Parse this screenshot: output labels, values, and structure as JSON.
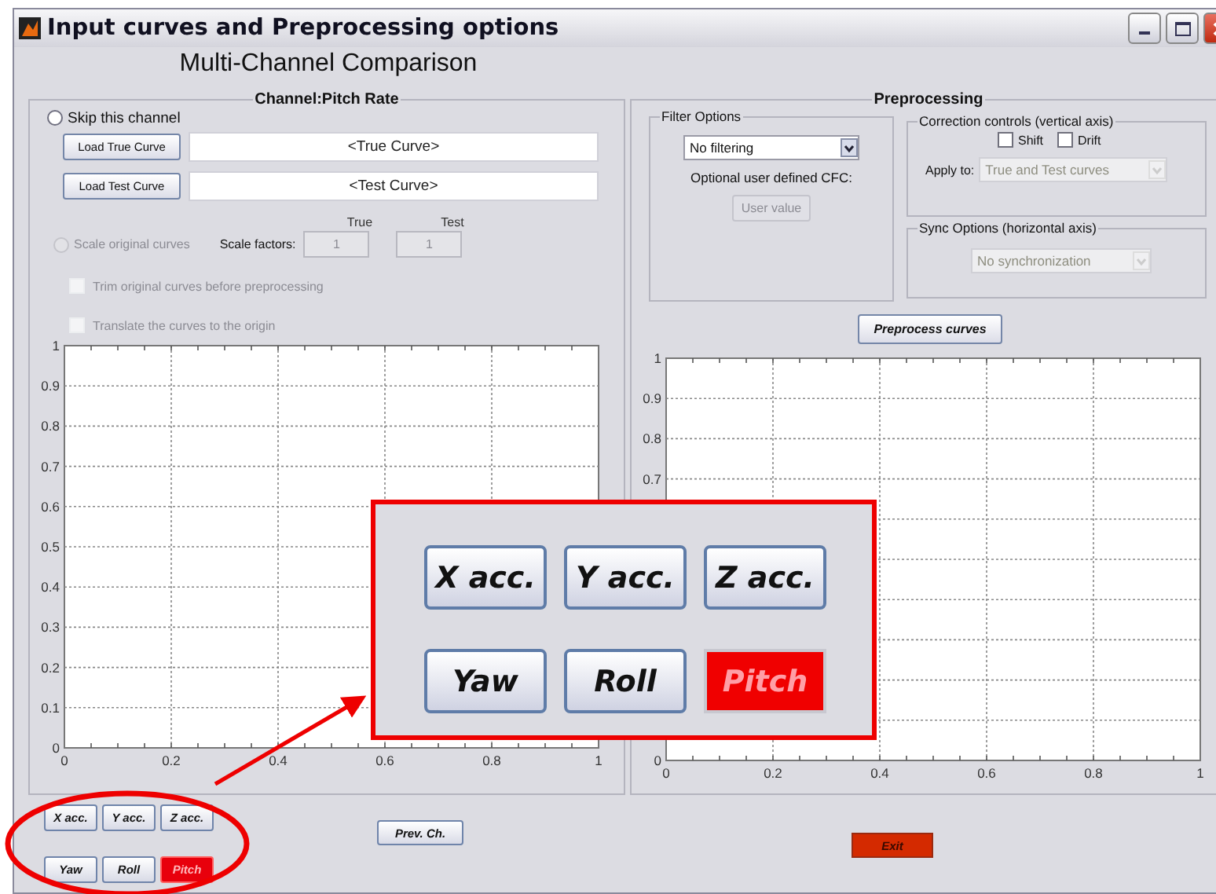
{
  "window": {
    "title": "Input curves and Preprocessing options"
  },
  "heading": "Multi-Channel Comparison",
  "channel_panel": {
    "title": "Channel:Pitch Rate",
    "skip": {
      "label": "Skip this channel",
      "selected": false,
      "disabled": false
    },
    "load_true": {
      "label": "Load True Curve",
      "value": "<True Curve>"
    },
    "load_test": {
      "label": "Load Test Curve",
      "value": "<Test Curve>"
    },
    "scale": {
      "label": "Scale original curves",
      "selected": false,
      "disabled": true,
      "factors_label": "Scale factors:",
      "fields": [
        {
          "header": "True",
          "value": "1",
          "disabled": true
        },
        {
          "header": "Test",
          "value": "1",
          "disabled": true
        }
      ]
    },
    "options": [
      {
        "label": "Trim original curves before preprocessing",
        "checked": false,
        "disabled": true
      },
      {
        "label": "Translate the curves to the origin",
        "checked": false,
        "disabled": true
      }
    ],
    "chart_data": {
      "type": "line",
      "grid": true,
      "xlim": [
        0,
        1
      ],
      "ylim": [
        0,
        1
      ],
      "xticks": [
        0,
        0.2,
        0.4,
        0.6,
        0.8,
        1
      ],
      "yticks": [
        0,
        0.1,
        0.2,
        0.3,
        0.4,
        0.5,
        0.6,
        0.7,
        0.8,
        0.9,
        1
      ]
    }
  },
  "preprocessing_panel": {
    "title": "Preprocessing",
    "filter": {
      "title": "Filter Options",
      "dropdown": {
        "value": "No filtering",
        "disabled": false
      },
      "cfc_label": "Optional user defined CFC:",
      "user_value": {
        "label": "User value",
        "disabled": true
      }
    },
    "correction": {
      "title": "Correction controls (vertical axis)",
      "checks": [
        {
          "label": "Shift",
          "checked": false,
          "disabled": false
        },
        {
          "label": "Drift",
          "checked": false,
          "disabled": false
        }
      ],
      "apply_label": "Apply to:",
      "apply": {
        "value": "True and Test curves",
        "disabled": true
      }
    },
    "sync": {
      "title": "Sync Options (horizontal axis)",
      "dropdown": {
        "value": "No synchronization",
        "disabled": true
      }
    },
    "preprocess_button": "Preprocess curves",
    "chart_data": {
      "type": "line",
      "grid": true,
      "xlim": [
        0,
        1
      ],
      "ylim": [
        0,
        1
      ],
      "xticks": [
        0,
        0.2,
        0.4,
        0.6,
        0.8,
        1
      ],
      "yticks": [
        0,
        0.7,
        0.8,
        0.9,
        1
      ]
    }
  },
  "channel_buttons": [
    {
      "label": "X acc.",
      "selected": false
    },
    {
      "label": "Y acc.",
      "selected": false
    },
    {
      "label": "Z acc.",
      "selected": false
    },
    {
      "label": "Yaw",
      "selected": false
    },
    {
      "label": "Roll",
      "selected": false
    },
    {
      "label": "Pitch",
      "selected": true
    }
  ],
  "prev_button": "Prev. Ch.",
  "exit_button": "Exit",
  "callout": {
    "buttons": [
      {
        "label": "X acc.",
        "selected": false
      },
      {
        "label": "Y acc.",
        "selected": false
      },
      {
        "label": "Z acc.",
        "selected": false
      },
      {
        "label": "Yaw",
        "selected": false
      },
      {
        "label": "Roll",
        "selected": false
      },
      {
        "label": "Pitch",
        "selected": true
      }
    ]
  }
}
